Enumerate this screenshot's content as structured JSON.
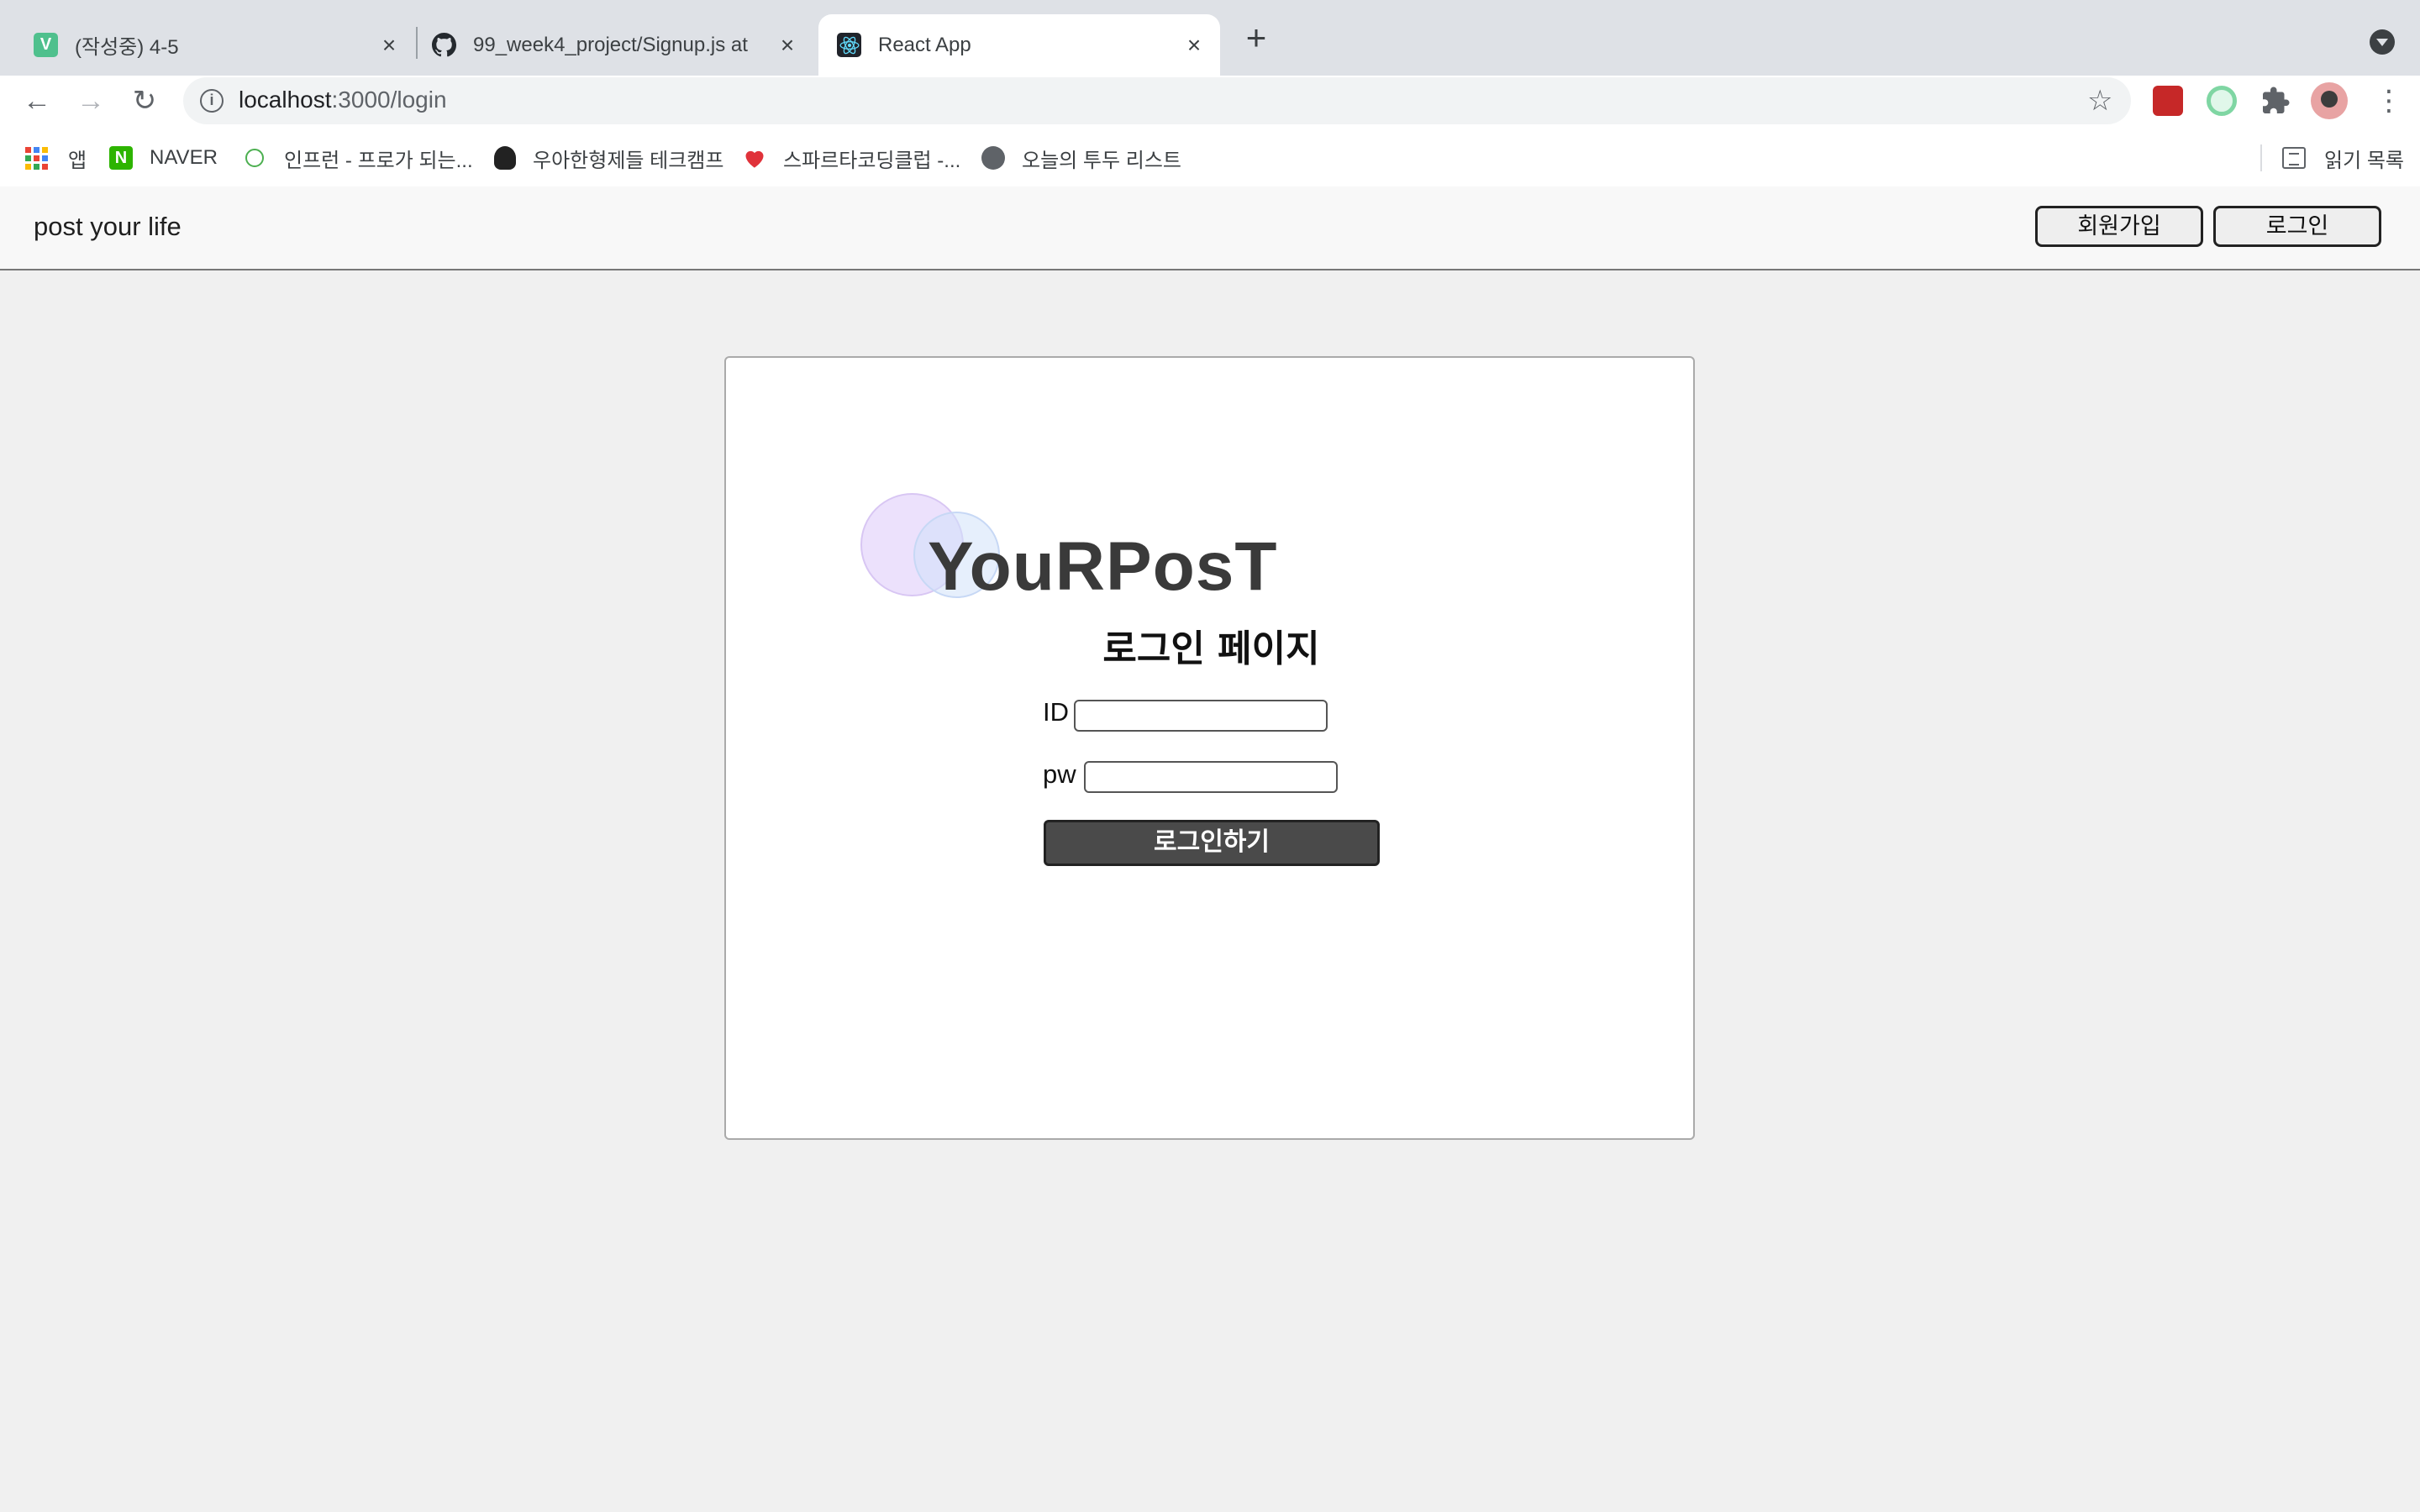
{
  "browser": {
    "tabs": [
      {
        "title": "(작성중) 4-5",
        "favicon": "V",
        "favicon_color": "#4fc08d",
        "active": false
      },
      {
        "title": "99_week4_project/Signup.js at",
        "favicon": "github-icon",
        "active": false
      },
      {
        "title": "React App",
        "favicon": "react-icon",
        "active": true
      }
    ],
    "new_tab": "+",
    "url_host": "localhost",
    "url_rest": ":3000/login",
    "bookmarks": [
      {
        "label": "앱",
        "icon": "apps-grid-icon"
      },
      {
        "label": "NAVER",
        "icon": "N",
        "color": "#2db400"
      },
      {
        "label": "인프런 - 프로가 되는...",
        "icon": "inflearn-icon",
        "color": "#4caf50"
      },
      {
        "label": "우아한형제들 테크캠프",
        "icon": "woowa-icon"
      },
      {
        "label": "스파르타코딩클럽 -...",
        "icon": "sparta-icon",
        "color": "#e0323a"
      },
      {
        "label": "오늘의 투두 리스트",
        "icon": "globe-icon"
      }
    ],
    "reading_list": "읽기 목록"
  },
  "app": {
    "site_title": "post your life",
    "signup_label": "회원가입",
    "login_label": "로그인"
  },
  "login": {
    "logo": "YouRPosT",
    "heading": "로그인 페이지",
    "id_label": "ID",
    "pw_label": "pw",
    "id_value": "",
    "pw_value": "",
    "submit_label": "로그인하기"
  }
}
